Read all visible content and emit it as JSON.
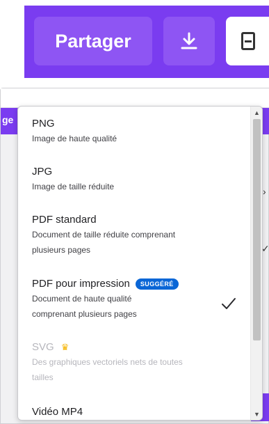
{
  "toolbar": {
    "share_label": "Partager",
    "download_icon": "download-icon",
    "more_icon": "more-options-icon"
  },
  "background": {
    "cut_tab_text": "ge"
  },
  "dropdown": {
    "options": [
      {
        "title": "PNG",
        "desc": "Image de haute qualité"
      },
      {
        "title": "JPG",
        "desc": "Image de taille réduite"
      },
      {
        "title": "PDF standard",
        "desc1": "Document de taille réduite comprenant",
        "desc2": "plusieurs pages"
      },
      {
        "title": "PDF pour impression",
        "badge": "SUGGÉRÉ",
        "desc1": "Document de haute qualité",
        "desc2": "comprenant plusieurs pages",
        "selected": true
      },
      {
        "title": "SVG",
        "premium_icon": "crown-icon",
        "desc1": "Des graphiques vectoriels nets de toutes",
        "desc2": "tailles",
        "disabled": true
      },
      {
        "title": "Vidéo MP4"
      }
    ]
  },
  "colors": {
    "brand_purple": "#7a3cf0",
    "button_purple": "#8e55f3",
    "badge_blue": "#0a66d6",
    "crown_gold": "#f5b301"
  }
}
